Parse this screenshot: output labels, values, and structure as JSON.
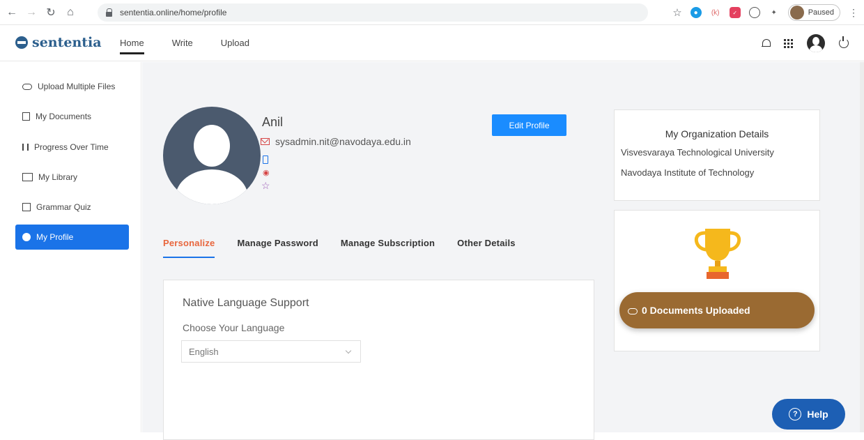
{
  "browser": {
    "url": "sententia.online/home/profile",
    "paused_label": "Paused"
  },
  "app": {
    "logo": "sententia",
    "nav": [
      "Home",
      "Write",
      "Upload"
    ]
  },
  "sidebar": {
    "items": [
      {
        "label": "Upload Multiple Files",
        "icon": "cloud-upload-icon"
      },
      {
        "label": "My Documents",
        "icon": "documents-icon"
      },
      {
        "label": "Progress Over Time",
        "icon": "bar-chart-icon"
      },
      {
        "label": "My Library",
        "icon": "book-icon"
      },
      {
        "label": "Grammar Quiz",
        "icon": "quiz-icon"
      },
      {
        "label": "My Profile",
        "icon": "user-circle-icon"
      }
    ]
  },
  "profile": {
    "name": "Anil",
    "email": "sysadmin.nit@navodaya.edu.in",
    "edit_button": "Edit Profile"
  },
  "tabs": [
    "Personalize",
    "Manage Password",
    "Manage Subscription",
    "Other Details"
  ],
  "personalize": {
    "title": "Native Language Support",
    "label": "Choose Your Language",
    "selected_language": "English"
  },
  "organization": {
    "title": "My Organization Details",
    "university": "Visvesvaraya Technological University",
    "institute": "Navodaya Institute of Technology"
  },
  "documents": {
    "uploaded_label": "0 Documents Uploaded"
  },
  "help": {
    "label": "Help"
  },
  "colors": {
    "primary": "#1a73e8",
    "accent_tab": "#e8663d",
    "documents_pill": "#9a6a32",
    "help_button": "#1d5fb4"
  }
}
